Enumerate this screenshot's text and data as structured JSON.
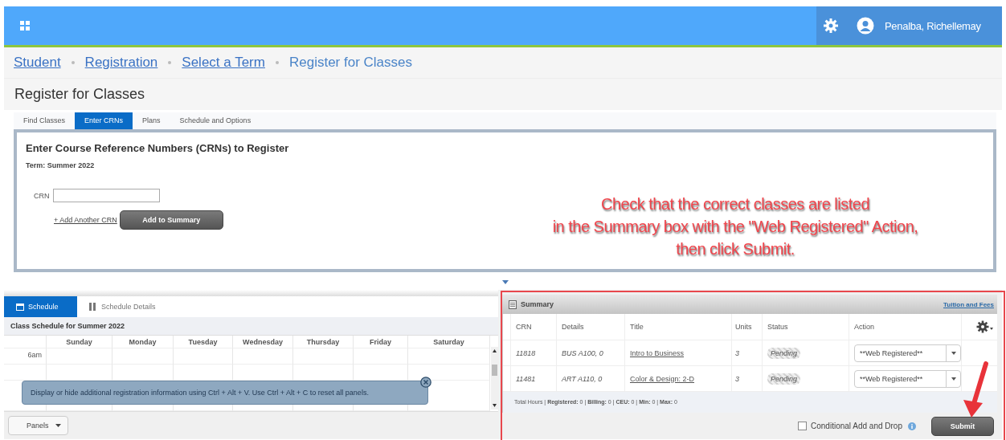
{
  "header": {
    "user_name": "Penalba, Richellemay"
  },
  "breadcrumb": [
    {
      "label": "Student",
      "kind": "link"
    },
    {
      "label": "Registration",
      "kind": "link"
    },
    {
      "label": "Select a Term",
      "kind": "link"
    },
    {
      "label": "Register for Classes",
      "kind": "current"
    }
  ],
  "page_title": "Register for Classes",
  "tabs": [
    {
      "label": "Find Classes",
      "selected": false
    },
    {
      "label": "Enter CRNs",
      "selected": true
    },
    {
      "label": "Plans",
      "selected": false
    },
    {
      "label": "Schedule and Options",
      "selected": false
    }
  ],
  "crn_form": {
    "heading": "Enter Course Reference Numbers (CRNs) to Register",
    "term": "Term: Summer 2022",
    "crn_label": "CRN",
    "add_link": "+ Add Another CRN",
    "add_button": "Add to Summary"
  },
  "annotation": {
    "lines": [
      "Check that the correct classes are listed",
      "in the Summary box with the \"Web Registered\" Action,",
      "then click Submit."
    ]
  },
  "schedule": {
    "tabs": [
      {
        "label": "Schedule",
        "selected": true
      },
      {
        "label": "Schedule Details",
        "selected": false
      }
    ],
    "title": "Class Schedule for Summer 2022",
    "days": [
      "Sunday",
      "Monday",
      "Tuesday",
      "Wednesday",
      "Thursday",
      "Friday",
      "Saturday"
    ],
    "time_labels": [
      "6am"
    ]
  },
  "tooltip": {
    "text": "Display or hide additional registration information using Ctrl + Alt + V. Use Ctrl + Alt + C to reset all panels."
  },
  "panels_button": "Panels",
  "summary": {
    "title": "Summary",
    "link": "Tuition and Fees",
    "columns": [
      "CRN",
      "Details",
      "Title",
      "Units",
      "Status",
      "Action"
    ],
    "rows": [
      {
        "crn": "11818",
        "details": "BUS A100, 0",
        "title": "Intro to Business",
        "units": "3",
        "status": "Pending",
        "action": "**Web Registered**"
      },
      {
        "crn": "11481",
        "details": "ART A110, 0",
        "title": "Color & Design: 2-D",
        "units": "3",
        "status": "Pending",
        "action": "**Web Registered**"
      }
    ],
    "totals": "Total Hours | **Registered:** 0 | **Billing:** 0 | **CEU:** 0 | **Min:** 0 | **Max:** 0",
    "conditional": {
      "label": "Conditional Add and Drop",
      "checked": false
    },
    "submit": "Submit"
  }
}
